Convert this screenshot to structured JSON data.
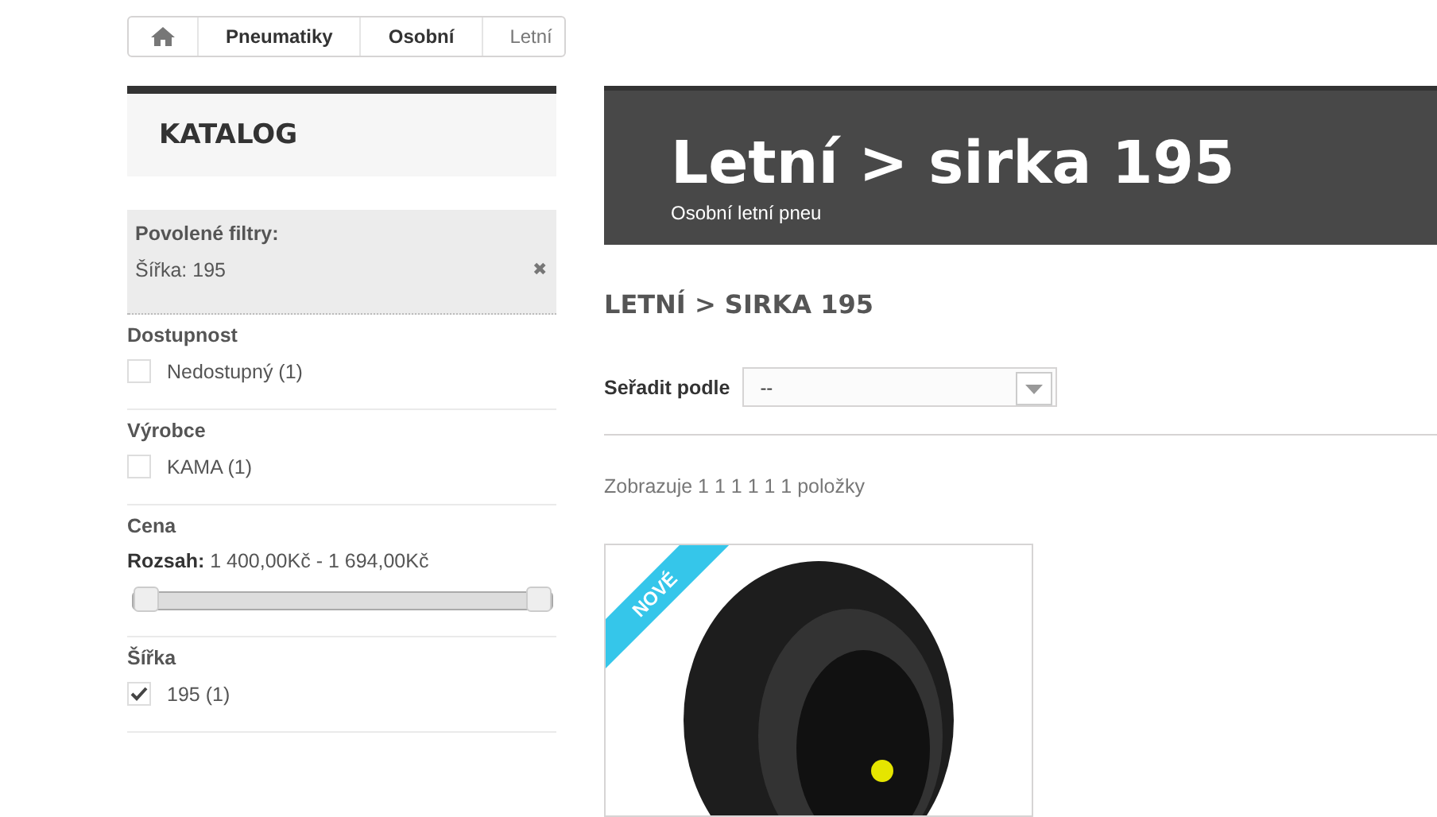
{
  "breadcrumb": [
    {
      "label": "Pneumatiky",
      "current": false
    },
    {
      "label": "Osobní",
      "current": false
    },
    {
      "label": "Letní",
      "current": true
    }
  ],
  "sidebar": {
    "title": "KATALOG",
    "active_filters": {
      "title": "Povolené filtry:",
      "items": [
        {
          "label": "Šířka: 195",
          "remove": "✖"
        }
      ]
    },
    "groups": [
      {
        "title": "Dostupnost",
        "kind": "checkbox",
        "options": [
          {
            "label": "Nedostupný (1)",
            "checked": false
          }
        ]
      },
      {
        "title": "Výrobce",
        "kind": "checkbox",
        "options": [
          {
            "label": "KAMA (1)",
            "checked": false
          }
        ]
      },
      {
        "title": "Cena",
        "kind": "range",
        "range_label": "Rozsah:",
        "range_value": "1 400,00Kč - 1 694,00Kč",
        "thumbs": [
          {
            "level": 0
          },
          {
            "level": 1
          }
        ]
      },
      {
        "title": "Šířka",
        "kind": "checkbox",
        "options": [
          {
            "label": "195 (1)",
            "checked": true
          }
        ]
      }
    ]
  },
  "banner": {
    "title": "Letní > sirka 195",
    "subtitle": "Osobní letní pneu"
  },
  "heading": "LETNÍ > SIRKA 195",
  "sort": {
    "label": "Seřadit podle",
    "value": "--"
  },
  "count": "Zobrazuje 1 1 1 1 1 1 položky",
  "products": [
    {
      "badge": "NOVÉ"
    }
  ]
}
